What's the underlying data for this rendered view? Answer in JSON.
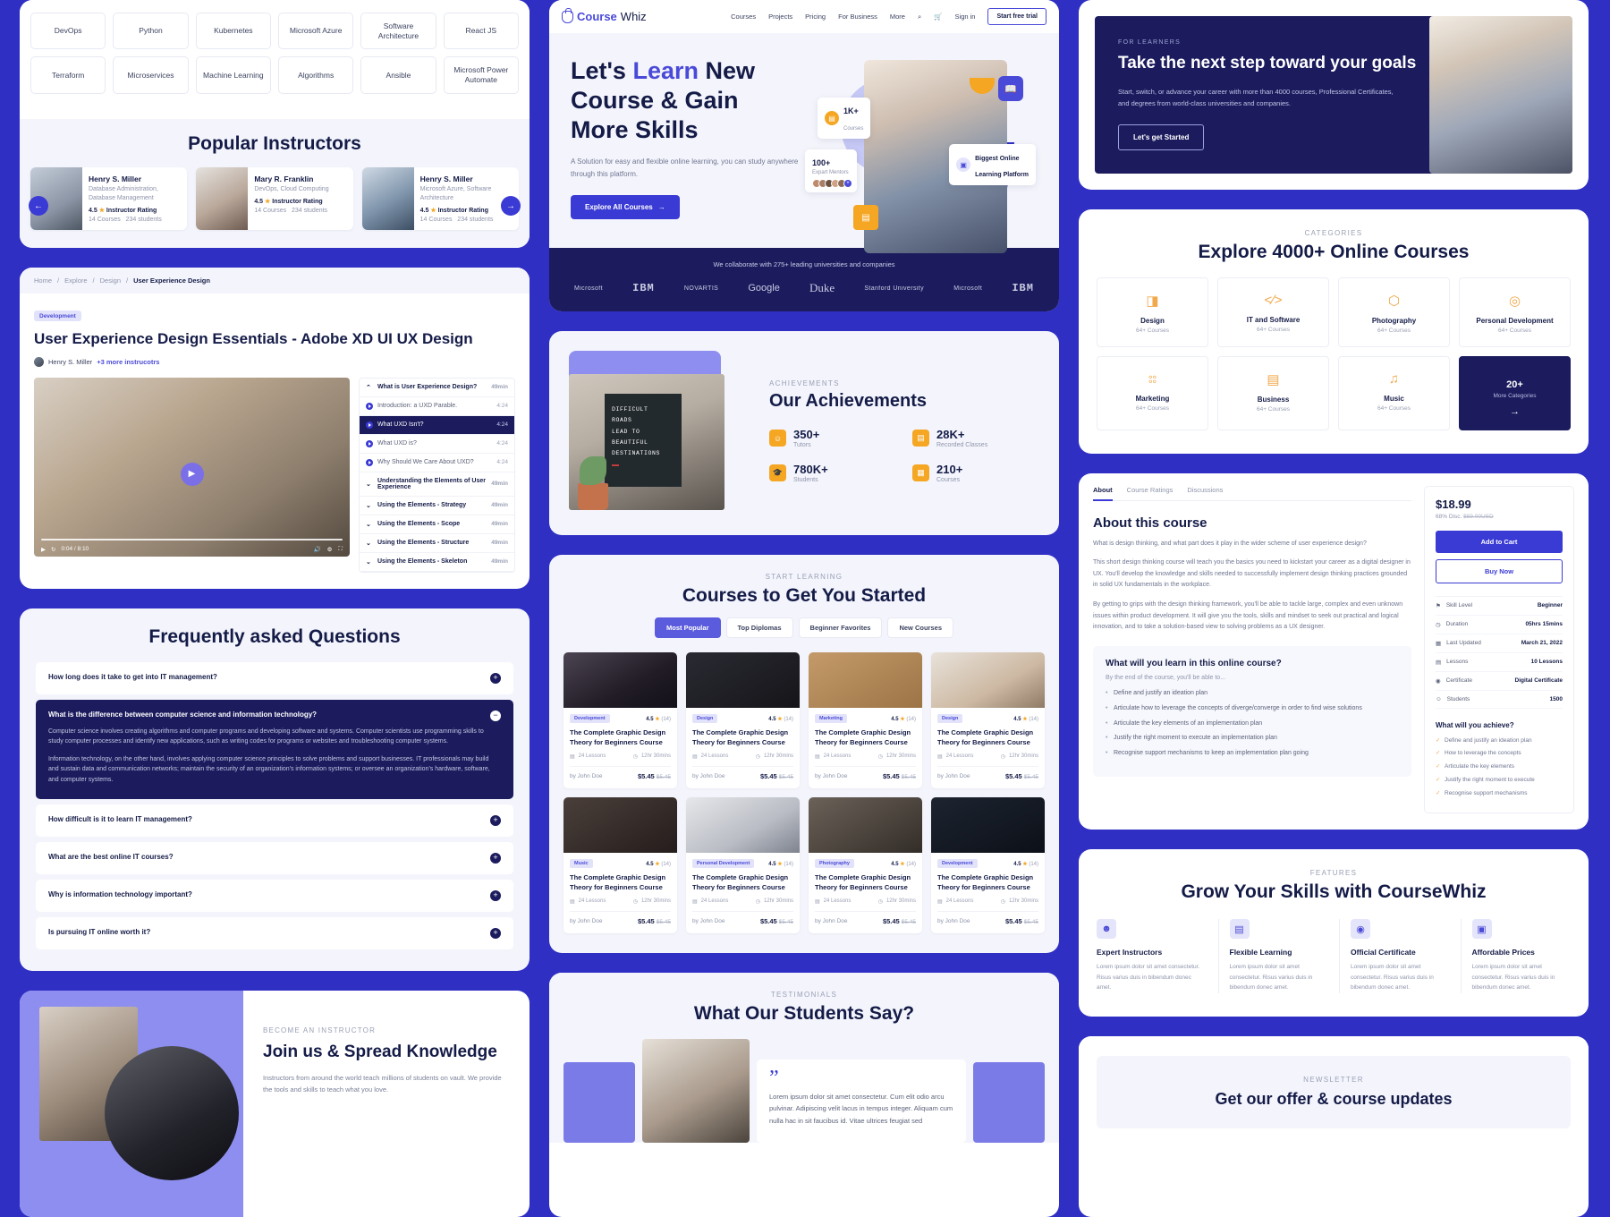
{
  "brand": {
    "name_bold": "Course",
    "name_light": "Whiz",
    "accent": "#4a4ad8",
    "navy": "#141b47",
    "deep": "#1b1b5e",
    "orange": "#f5a623"
  },
  "tags": {
    "row1": [
      "DevOps",
      "Python",
      "Kubernetes",
      "Microsoft Azure",
      "Software Architecture",
      "React JS"
    ],
    "row2": [
      "Terraform",
      "Microservices",
      "Machine Learning",
      "Algorithms",
      "Ansible",
      "Microsoft Power Automate"
    ]
  },
  "instructors": {
    "title": "Popular Instructors",
    "items": [
      {
        "name": "Henry S. Miller",
        "subject": "Database Administration, Database Management",
        "rating": "4.5",
        "rating_label": "Instructor Rating",
        "courses": "14 Courses",
        "students": "234 students"
      },
      {
        "name": "Mary R. Franklin",
        "subject": "DevOps, Cloud Computing",
        "rating": "4.5",
        "rating_label": "Instructor Rating",
        "courses": "14 Courses",
        "students": "234 students"
      },
      {
        "name": "Henry S. Miller",
        "subject": "Microsoft Azure, Software Architecture",
        "rating": "4.5",
        "rating_label": "Instructor Rating",
        "courses": "14 Courses",
        "students": "234 students"
      }
    ]
  },
  "course_detail": {
    "breadcrumb": [
      "Home",
      "Explore",
      "Design",
      "User Experience Design"
    ],
    "chip": "Development",
    "title": "User Experience Design Essentials - Adobe XD UI UX Design",
    "author": "Henry S. Miller",
    "more_instructors": "+3 more instrucotrs",
    "player": {
      "time": "0:04 / 8:10"
    },
    "lessons": [
      {
        "type": "section",
        "label": "What is User Experience Design?",
        "dur": "49min",
        "open": true
      },
      {
        "type": "lesson",
        "label": "Introduction: a UXD Parable.",
        "dur": "4:24",
        "active": false
      },
      {
        "type": "lesson",
        "label": "What UXD Isn't?",
        "dur": "4:24",
        "active": true
      },
      {
        "type": "lesson",
        "label": "What UXD is?",
        "dur": "4:24",
        "active": false
      },
      {
        "type": "lesson",
        "label": "Why Should We Care About UXD?",
        "dur": "4:24",
        "active": false
      },
      {
        "type": "section",
        "label": "Understanding the Elements of User Experience",
        "dur": "49min",
        "open": false
      },
      {
        "type": "section",
        "label": "Using the Elements - Strategy",
        "dur": "49min",
        "open": false
      },
      {
        "type": "section",
        "label": "Using the Elements - Scope",
        "dur": "49min",
        "open": false
      },
      {
        "type": "section",
        "label": "Using the Elements - Structure",
        "dur": "49min",
        "open": false
      },
      {
        "type": "section",
        "label": "Using the Elements - Skeleton",
        "dur": "49min",
        "open": false
      }
    ]
  },
  "faq": {
    "title": "Frequently asked Questions",
    "items": [
      {
        "q": "How long does it take to get into IT management?",
        "open": false
      },
      {
        "q": "What is the difference between computer science and information technology?",
        "open": true,
        "a1": "Computer science involves creating algorithms and computer programs and developing software and systems. Computer scientists use programming skills to study computer processes and identify new applications, such as writing codes for programs or websites and troubleshooting computer systems.",
        "a2": "Information technology, on the other hand, involves applying computer science principles to solve problems and support businesses. IT professionals may build and sustain data and communication networks; maintain the security of an organization's information systems; or oversee an organization's hardware, software, and computer systems."
      },
      {
        "q": "How difficult is it to learn IT management?",
        "open": false
      },
      {
        "q": "What are the best online IT courses?",
        "open": false
      },
      {
        "q": "Why is information technology important?",
        "open": false
      },
      {
        "q": "Is pursuing IT online worth it?",
        "open": false
      }
    ]
  },
  "join": {
    "eyebrow": "BECOME AN INSTRUCTOR",
    "title": "Join us & Spread Knowledge",
    "para": "Instructors from around the world teach millions of students on vault. We provide the tools and skills to teach what you love."
  },
  "home": {
    "nav": [
      "Courses",
      "Projects",
      "Pricing",
      "For Business",
      "More"
    ],
    "signin": "Sign in",
    "trial": "Start free trial",
    "hero": {
      "line1_a": "Let's ",
      "line1_b": "Learn",
      "line1_c": " New",
      "line2": "Course & Gain",
      "line3": "More Skills",
      "para": "A Solution for easy and flexible online learning, you can study anywhere through this platform.",
      "cta": "Explore All Courses",
      "pill_courses_n": "1K+",
      "pill_courses_l": "Courses",
      "pill_mentors_n": "100+",
      "pill_mentors_l": "Expart Mentors",
      "pill_big_l1": "Biggest Online",
      "pill_big_l2": "Learning Platform"
    },
    "collab": {
      "text": "We collaborate with 275+ leading universities and companies",
      "logos": [
        "Microsoft",
        "IBM",
        "NOVARTIS",
        "Google",
        "Duke",
        "Stanford University",
        "Microsoft",
        "IBM"
      ]
    }
  },
  "achievements": {
    "eyebrow": "ACHIEVEMENTS",
    "title": "Our Achievements",
    "poster": [
      "DIFFICULT",
      "ROADS",
      "LEAD TO",
      "BEAUTIFUL",
      "DESTINATIONS"
    ],
    "items": [
      {
        "n": "350+",
        "l": "Tutors"
      },
      {
        "n": "28K+",
        "l": "Recorded Classes"
      },
      {
        "n": "780K+",
        "l": "Students"
      },
      {
        "n": "210+",
        "l": "Courses"
      }
    ]
  },
  "courses": {
    "eyebrow": "START LEARNING",
    "title": "Courses to Get You Started",
    "tabs": [
      "Most Popular",
      "Top Diplomas",
      "Beginner Favorites",
      "New Courses"
    ],
    "active_tab": "Most Popular",
    "items": [
      {
        "chip": "Development",
        "rating": "4.5",
        "count": "(14)",
        "title": "The Complete Graphic Design Theory for Beginners Course",
        "lessons": "24 Lessons",
        "time": "12hr 30mins",
        "author": "by John Doe",
        "price": "$5.45",
        "old": "$5.45"
      },
      {
        "chip": "Design",
        "rating": "4.5",
        "count": "(14)",
        "title": "The Complete Graphic Design Theory for Beginners Course",
        "lessons": "24 Lessons",
        "time": "12hr 30mins",
        "author": "by John Doe",
        "price": "$5.45",
        "old": "$5.45"
      },
      {
        "chip": "Marketing",
        "rating": "4.5",
        "count": "(14)",
        "title": "The Complete Graphic Design Theory for Beginners Course",
        "lessons": "24 Lessons",
        "time": "12hr 30mins",
        "author": "by John Doe",
        "price": "$5.45",
        "old": "$5.45"
      },
      {
        "chip": "Design",
        "rating": "4.5",
        "count": "(14)",
        "title": "The Complete Graphic Design Theory for Beginners Course",
        "lessons": "24 Lessons",
        "time": "12hr 30mins",
        "author": "by John Doe",
        "price": "$5.45",
        "old": "$5.45"
      },
      {
        "chip": "Music",
        "rating": "4.5",
        "count": "(14)",
        "title": "The Complete Graphic Design Theory for Beginners Course",
        "lessons": "24 Lessons",
        "time": "12hr 30mins",
        "author": "by John Doe",
        "price": "$5.45",
        "old": "$5.45"
      },
      {
        "chip": "Personal Development",
        "rating": "4.5",
        "count": "(14)",
        "title": "The Complete Graphic Design Theory for Beginners Course",
        "lessons": "24 Lessons",
        "time": "12hr 30mins",
        "author": "by John Doe",
        "price": "$5.45",
        "old": "$5.45"
      },
      {
        "chip": "Photography",
        "rating": "4.5",
        "count": "(14)",
        "title": "The Complete Graphic Design Theory for Beginners Course",
        "lessons": "24 Lessons",
        "time": "12hr 30mins",
        "author": "by John Doe",
        "price": "$5.45",
        "old": "$5.45"
      },
      {
        "chip": "Development",
        "rating": "4.5",
        "count": "(14)",
        "title": "The Complete Graphic Design Theory for Beginners Course",
        "lessons": "24 Lessons",
        "time": "12hr 30mins",
        "author": "by John Doe",
        "price": "$5.45",
        "old": "$5.45"
      }
    ]
  },
  "testimonials": {
    "eyebrow": "TESTIMONIALS",
    "title": "What Our Students Say?",
    "quote": "Lorem ipsum dolor sit amet consectetur. Cum elit odio arcu pulvinar. Adipiscing velit lacus in tempus integer. Aliquam cum nulla hac in sit faucibus id. Vitae ultrices feugiat sed"
  },
  "banner": {
    "eyebrow": "FOR LEARNERS",
    "title": "Take the next step toward your goals",
    "para": "Start, switch, or advance your career with more than 4000 courses, Professional Certificates, and degrees from world-class universities and companies.",
    "cta": "Let's get Started"
  },
  "categories": {
    "eyebrow": "CATEGORIES",
    "title": "Explore 4000+ Online Courses",
    "items": [
      {
        "icon": "design-icon",
        "glyph": "◨",
        "name": "Design",
        "count": "64+ Courses"
      },
      {
        "icon": "code-icon",
        "glyph": "‹›",
        "name": "IT and Software",
        "count": "64+ Courses"
      },
      {
        "icon": "camera-icon",
        "glyph": "⬡",
        "name": "Photography",
        "count": "64+ Courses"
      },
      {
        "icon": "target-icon",
        "glyph": "◎",
        "name": "Personal Development",
        "count": "64+ Courses"
      },
      {
        "icon": "grid-icon",
        "glyph": "⠿",
        "name": "Marketing",
        "count": "64+ Courses"
      },
      {
        "icon": "briefcase-icon",
        "glyph": "🗂",
        "name": "Business",
        "count": "64+ Courses"
      },
      {
        "icon": "music-icon",
        "glyph": "♫",
        "name": "Music",
        "count": "64+ Courses"
      }
    ],
    "more": {
      "n": "20+",
      "l": "More Categories"
    }
  },
  "about": {
    "tabs": [
      "About",
      "Course Ratings",
      "Discussions"
    ],
    "active_tab": "About",
    "title": "About this course",
    "p1": "What is design thinking, and what part does it play in the wider scheme of user experience design?",
    "p2": "This short design thinking course will teach you the basics you need to kickstart your career as a digital designer in UX. You'll develop the knowledge and skills needed to successfully implement design thinking practices grounded in solid UX fundamentals in the workplace.",
    "p3": "By getting to grips with the design thinking framework, you'll be able to tackle large, complex and even unknown issues within product development. It will give you the tools, skills and mindset to seek out practical and logical innovation, and to take a solution-based view to solving problems as a UX designer.",
    "learn_title": "What will you learn in this online course?",
    "learn_sub": "By the end of the course, you'll be able to...",
    "learn_items": [
      "Define and justify an ideation plan",
      "Articulate how to leverage the concepts of diverge/converge in order to find wise solutions",
      "Articulate the key elements of an implementation plan",
      "Justify the right moment to execute an implementation plan",
      "Recognise support mechanisms to keep an implementation plan going"
    ],
    "price": "$18.99",
    "discount": "68% Disc.",
    "old_price": "$59.00USD",
    "add_to_cart": "Add to Cart",
    "buy_now": "Buy Now",
    "specs": [
      {
        "label": "Skill Level",
        "value": "Beginner"
      },
      {
        "label": "Duration",
        "value": "05hrs 15mins"
      },
      {
        "label": "Last Updated",
        "value": "March 21, 2022"
      },
      {
        "label": "Lessons",
        "value": "10 Lessons"
      },
      {
        "label": "Certificate",
        "value": "Digital Certificate"
      },
      {
        "label": "Students",
        "value": "1500"
      }
    ],
    "achieve_title": "What will you achieve?",
    "achieve_items": [
      "Define and justify an ideation plan",
      "How to leverage the concepts",
      "Articulate the key elements",
      "Justify the right moment to execute",
      "Recognise support mechanisms"
    ]
  },
  "features": {
    "eyebrow": "FEATURES",
    "title": "Grow Your Skills with CourseWhiz",
    "items": [
      {
        "icon": "users-icon",
        "glyph": "👤",
        "name": "Expert Instructors",
        "p": "Lorem ipsum dolor sit amet consectetur. Risus varius duis in bibendum donec amet."
      },
      {
        "icon": "book-icon",
        "glyph": "▤",
        "name": "Flexible Learning",
        "p": "Lorem ipsum dolor sit amet consectetur. Risus varius duis in bibendum donec amet."
      },
      {
        "icon": "award-icon",
        "glyph": "◉",
        "name": "Official Certificate",
        "p": "Lorem ipsum dolor sit amet consectetur. Risus varius duis in bibendum donec amet."
      },
      {
        "icon": "price-tag-icon",
        "glyph": "▣",
        "name": "Affordable Prices",
        "p": "Lorem ipsum dolor sit amet consectetur. Risus varius duis in bibendum donec amet."
      }
    ]
  },
  "newsletter": {
    "eyebrow": "NEWSLETTER",
    "title": "Get our offer & course updates"
  }
}
